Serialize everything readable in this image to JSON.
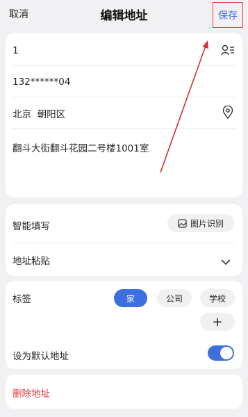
{
  "header": {
    "cancel_label": "取消",
    "title": "编辑地址",
    "save_label": "保存"
  },
  "address_form": {
    "name_value": "1",
    "phone_value": "132******04",
    "region_value": "北京  朝阳区",
    "detail_value": "翻斗大街翻斗花园二号楼1001室"
  },
  "smart_fill": {
    "label": "智能填写",
    "image_recognition_button": "图片识别",
    "paste_label": "地址粘贴"
  },
  "tags": {
    "label": "标签",
    "options": [
      "家",
      "公司",
      "学校"
    ],
    "selected": "家",
    "add_symbol": "+"
  },
  "default_address": {
    "label": "设为默认地址",
    "enabled": true
  },
  "delete": {
    "label": "删除地址"
  },
  "colors": {
    "accent": "#3d6fe0",
    "danger": "#e0393e",
    "highlight_box": "#e23b3b"
  }
}
